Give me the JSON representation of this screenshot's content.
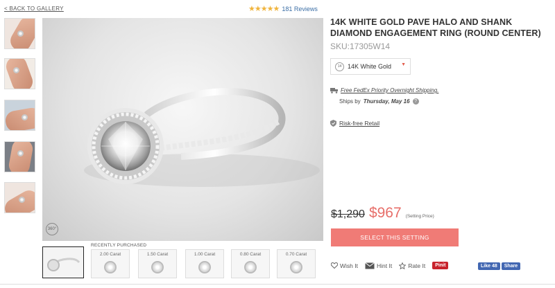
{
  "nav": {
    "back_label": "< BACK TO GALLERY"
  },
  "reviews": {
    "stars": "★★★★★",
    "rating": 5,
    "count_label": "181 Reviews"
  },
  "product": {
    "title": "14K WHITE GOLD PAVE HALO AND SHANK DIAMOND ENGAGEMENT RING (ROUND CENTER)",
    "sku": "SKU:17305W14",
    "metal": {
      "chip": "14",
      "label": "14K White Gold",
      "caret": "▼"
    },
    "shipping_link": "Free FedEx Priority Overnight Shipping.",
    "ships_by_prefix": "Ships by",
    "ships_by_date": "Thursday, May 16",
    "risk_free_label": "Risk-free Retail",
    "old_price": "$1,290",
    "new_price": "$967",
    "price_note": "(Setting Price)",
    "select_button": "SELECT THIS SETTING"
  },
  "main_image": {
    "badge_360": "360°"
  },
  "recently_purchased": {
    "label": "RECENTLY PURCHASED",
    "items": [
      {
        "carat": "2.00 Carat"
      },
      {
        "carat": "1.50 Carat"
      },
      {
        "carat": "1.00 Carat"
      },
      {
        "carat": "0.80 Carat"
      },
      {
        "carat": "0.70 Carat"
      }
    ]
  },
  "actions": {
    "wish": "Wish It",
    "hint": "Hint It",
    "rate": "Rate It",
    "pinit": "Pinit",
    "fb_like": "Like 48",
    "fb_share": "Share"
  },
  "colors": {
    "accent": "#f07b76",
    "sale_price": "#e76e69",
    "star": "#f0b43c",
    "link": "#3b6ea5"
  }
}
